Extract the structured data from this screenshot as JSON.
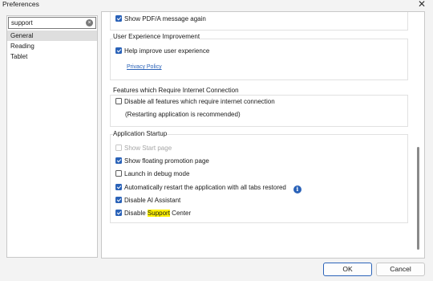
{
  "window": {
    "title": "Preferences",
    "close_glyph": "✕"
  },
  "search": {
    "value": "support",
    "clear_glyph": "×"
  },
  "nav": {
    "items": [
      {
        "label": "General",
        "selected": true
      },
      {
        "label": "Reading",
        "selected": false
      },
      {
        "label": "Tablet",
        "selected": false
      }
    ]
  },
  "settings": {
    "top_item": {
      "label": "Show PDF/A message again",
      "checked": true
    },
    "ux": {
      "title": "User Experience Improvement",
      "help_improve": {
        "label": "Help improve user experience",
        "checked": true
      },
      "privacy_link": "Privacy Policy"
    },
    "internet": {
      "title": "Features which Require Internet Connection",
      "disable_all": {
        "label": "Disable all features which require internet connection",
        "checked": false
      },
      "note": "(Restarting application is recommended)"
    },
    "startup": {
      "title": "Application Startup",
      "show_start_page": {
        "label": "Show Start page",
        "checked": false,
        "disabled": true
      },
      "floating_promo": {
        "label": "Show floating promotion page",
        "checked": true
      },
      "debug_mode": {
        "label": "Launch in debug mode",
        "checked": false
      },
      "restart_tabs": {
        "label": "Automatically restart the application with all tabs restored",
        "checked": true
      },
      "info_glyph": "i",
      "disable_ai": {
        "label": "Disable AI Assistant",
        "checked": true
      },
      "disable_support": {
        "label_prefix": "Disable ",
        "label_highlight": "Support",
        "label_suffix": " Center",
        "checked": true
      }
    }
  },
  "buttons": {
    "ok": "OK",
    "cancel": "Cancel"
  },
  "colors": {
    "accent": "#2a62b8",
    "search_highlight": "#fff200"
  }
}
